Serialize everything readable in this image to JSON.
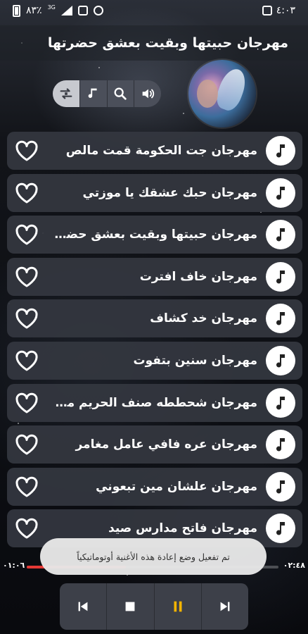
{
  "status": {
    "time": "٤:٠٣",
    "battery": "٨٣٪",
    "network": "3G"
  },
  "header": {
    "title": "مهرجان حبيتها وبقيت بعشق حضرتها"
  },
  "controls": {
    "repeat_icon": "repeat-icon",
    "music_icon": "music-note-icon",
    "search_icon": "search-icon",
    "volume_icon": "volume-icon"
  },
  "songs": [
    {
      "title": "مهرجان جت الحكومة قمت مالص"
    },
    {
      "title": "مهرجان حبك عشقك يا موزتي"
    },
    {
      "title": "مهرجان حبيتها وبقيت بعشق حضرتها"
    },
    {
      "title": "مهرجان خاف افترت"
    },
    {
      "title": "مهرجان خد كشاف"
    },
    {
      "title": "مهرجان سنين بتفوت"
    },
    {
      "title": "مهرجان شحططه صنف الحريم مرم..."
    },
    {
      "title": "مهرجان عره فافي عامل مغامر"
    },
    {
      "title": "مهرجان علشان مين تبعوني"
    },
    {
      "title": "مهرجان فاتح مدارس صيد"
    }
  ],
  "toast": {
    "message": "تم تفعيل وضع إعادة هذه الأغنية أوتوماتيكياً"
  },
  "player": {
    "elapsed": "٠١:٠٦",
    "duration": "٠٢:٤٨",
    "progress": 0.393,
    "accent": "#e53935"
  }
}
